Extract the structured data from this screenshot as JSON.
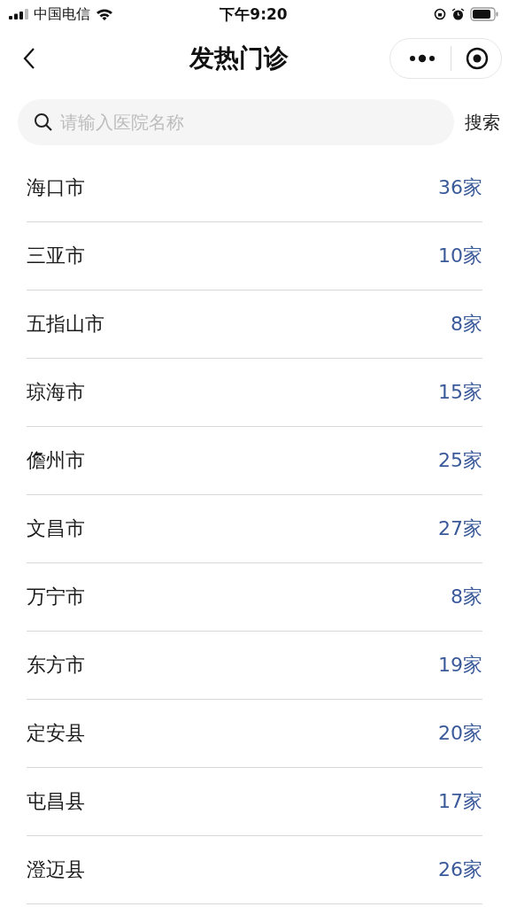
{
  "status_bar": {
    "carrier": "中国电信",
    "time": "下午9:20"
  },
  "nav": {
    "title": "发热门诊"
  },
  "search": {
    "placeholder": "请输入医院名称",
    "button": "搜索"
  },
  "cities": [
    {
      "name": "海口市",
      "count": "36家"
    },
    {
      "name": "三亚市",
      "count": "10家"
    },
    {
      "name": "五指山市",
      "count": "8家"
    },
    {
      "name": "琼海市",
      "count": "15家"
    },
    {
      "name": "儋州市",
      "count": "25家"
    },
    {
      "name": "文昌市",
      "count": "27家"
    },
    {
      "name": "万宁市",
      "count": "8家"
    },
    {
      "name": "东方市",
      "count": "19家"
    },
    {
      "name": "定安县",
      "count": "20家"
    },
    {
      "name": "屯昌县",
      "count": "17家"
    },
    {
      "name": "澄迈县",
      "count": "26家"
    }
  ]
}
